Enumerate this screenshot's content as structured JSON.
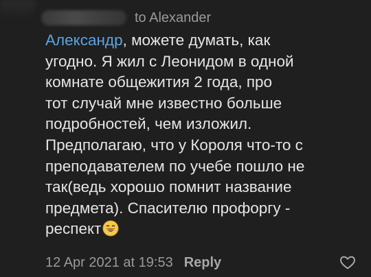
{
  "comment": {
    "reply_to": "to Alexander",
    "mention": "Александр",
    "text": ", можете думать, как\nугодно. Я жил с Леонидом в одной\nкомнате общежития 2 года, про\nтот случай мне известно больше\nподробностей, чем изложил.\nПредполагаю, что у Короля что-то с\nпреподавателем по учебе пошло не\nтак(ведь хорошо помнит название\nпредмета). Спасителю профоргу -\nреспект",
    "emoji": "grinning-face-emoji",
    "date": "12 Apr 2021 at 19:53",
    "reply_label": "Reply",
    "like_icon": "heart-icon"
  },
  "colors": {
    "background": "#1f1f1f",
    "text": "#e6e6e6",
    "mention": "#5fa3e0",
    "muted": "#9a9a9a"
  }
}
